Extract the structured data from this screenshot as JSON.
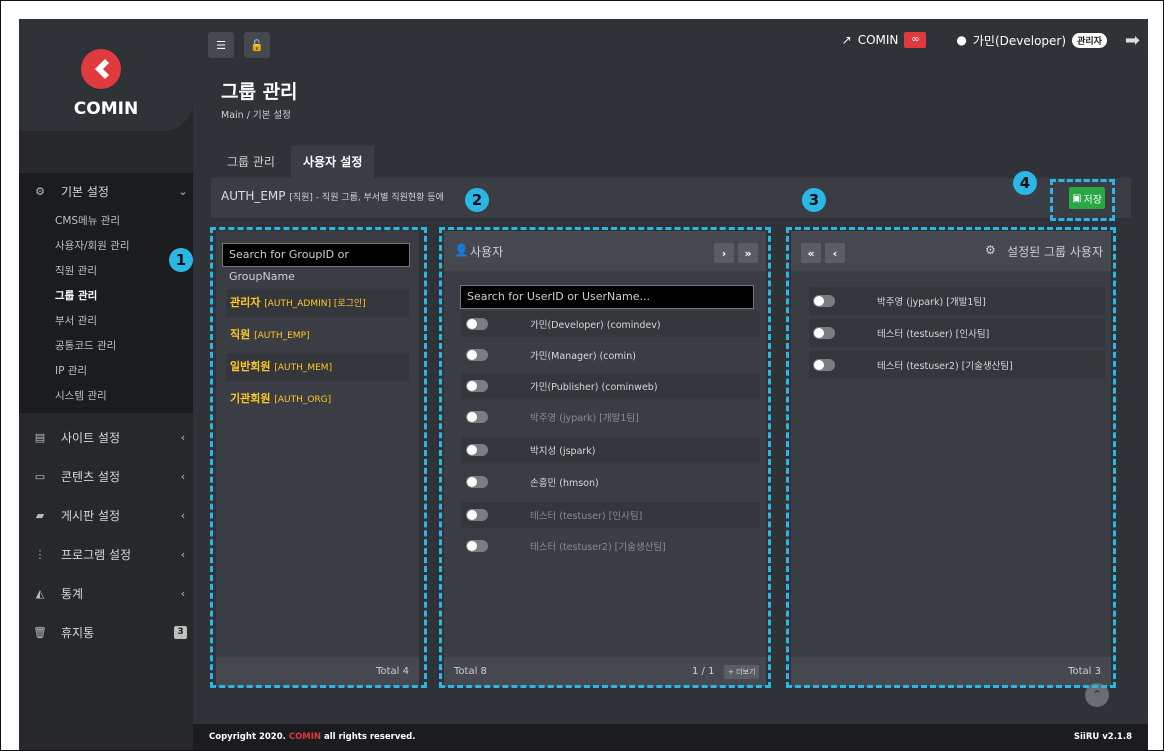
{
  "brand": {
    "name": "COMIN"
  },
  "sidebar": {
    "basic_settings": {
      "label": "기본 설정",
      "items": [
        {
          "label": "CMS메뉴 관리"
        },
        {
          "label": "사용자/회원 관리"
        },
        {
          "label": "직원 관리"
        },
        {
          "label": "그룹 관리"
        },
        {
          "label": "부서 관리"
        },
        {
          "label": "공통코드 관리"
        },
        {
          "label": "IP 관리"
        },
        {
          "label": "시스템 관리"
        }
      ]
    },
    "sections": [
      {
        "label": "사이트 설정"
      },
      {
        "label": "콘텐츠 설정"
      },
      {
        "label": "게시판 설정"
      },
      {
        "label": "프로그램 설정"
      },
      {
        "label": "통계"
      },
      {
        "label": "휴지통",
        "count": "3"
      }
    ]
  },
  "header": {
    "title": "그룹 관리",
    "breadcrumb": "Main / 기본 설정",
    "site_link": "COMIN",
    "user_name": "가민(Developer)",
    "user_role": "관리자"
  },
  "tabs": [
    {
      "label": "그룹 관리"
    },
    {
      "label": "사용자 설정"
    }
  ],
  "info_bar": {
    "group_id": "AUTH_EMP",
    "desc": "[직원] - 직원 그룹, 부서별 직원현황 등에",
    "save_label": "저장"
  },
  "group_panel": {
    "search_placeholder": "Search for GroupID or GroupName",
    "groups": [
      {
        "name": "관리자",
        "code": "[AUTH_ADMIN] [로그인]"
      },
      {
        "name": "직원",
        "code": "[AUTH_EMP]"
      },
      {
        "name": "일반회원",
        "code": "[AUTH_MEM]"
      },
      {
        "name": "기관회원",
        "code": "[AUTH_ORG]"
      }
    ],
    "total": "Total 4"
  },
  "user_panel": {
    "title": "사용자",
    "search_placeholder": "Search for UserID or UserName...",
    "users": [
      {
        "name": "가민(Developer) (comindev)"
      },
      {
        "name": "가민(Manager) (comin)"
      },
      {
        "name": "가민(Publisher) (cominweb)"
      },
      {
        "name": "박주영 (jypark) [개발1팀]"
      },
      {
        "name": "박지성 (jspark)"
      },
      {
        "name": "손흥민 (hmson)"
      },
      {
        "name": "테스터 (testuser) [인사팀]"
      },
      {
        "name": "테스터 (testuser2) [기술생산팀]"
      }
    ],
    "total": "Total 8",
    "page": "1 / 1",
    "more_label": "+ 더보기"
  },
  "assigned_panel": {
    "title": "설정된 그룹 사용자",
    "users": [
      {
        "name": "박주영 (jypark) [개발1팀]"
      },
      {
        "name": "테스터 (testuser) [인사팀]"
      },
      {
        "name": "테스터 (testuser2) [기술생산팀]"
      }
    ],
    "total": "Total 3"
  },
  "annotations": [
    "1",
    "2",
    "3",
    "4"
  ],
  "footer": {
    "copyright_prefix": "Copyright 2020.",
    "copyright_brand": "COMIN",
    "copyright_suffix": "all rights reserved.",
    "version": "SiiRU v2.1.8"
  },
  "colors": {
    "accent": "#e03a3e",
    "highlight": "#2bb7e6",
    "group_text": "#ffc829",
    "save": "#28a745"
  }
}
